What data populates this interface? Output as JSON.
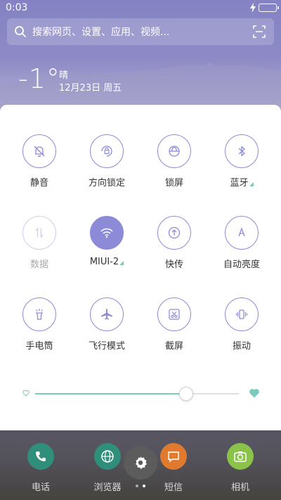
{
  "status_bar": {
    "time": "0:03"
  },
  "search": {
    "placeholder": "搜索网页、设置、应用、视频..."
  },
  "weather": {
    "temperature": "-1°",
    "condition": "晴",
    "date": "12月23日 周五"
  },
  "tiles": [
    {
      "label": "静音",
      "icon": "bell-off-icon",
      "state": "off"
    },
    {
      "label": "方向锁定",
      "icon": "rotation-lock-icon",
      "state": "off"
    },
    {
      "label": "锁屏",
      "icon": "lock-icon",
      "state": "off"
    },
    {
      "label": "蓝牙",
      "icon": "bluetooth-icon",
      "state": "off",
      "has_more": true
    },
    {
      "label": "数据",
      "icon": "mobile-data-icon",
      "state": "disabled"
    },
    {
      "label": "MIUI-2",
      "icon": "wifi-icon",
      "state": "on",
      "has_more": true
    },
    {
      "label": "快传",
      "icon": "quick-transfer-icon",
      "state": "off"
    },
    {
      "label": "自动亮度",
      "icon": "auto-brightness-icon",
      "state": "off"
    },
    {
      "label": "手电筒",
      "icon": "flashlight-icon",
      "state": "off"
    },
    {
      "label": "飞行模式",
      "icon": "airplane-icon",
      "state": "off"
    },
    {
      "label": "截屏",
      "icon": "screenshot-icon",
      "state": "off"
    },
    {
      "label": "振动",
      "icon": "vibrate-icon",
      "state": "off"
    }
  ],
  "brightness": {
    "level": 0.74
  },
  "dock": [
    {
      "label": "电话",
      "icon": "phone-icon",
      "color": "#2f8f7a"
    },
    {
      "label": "浏览器",
      "icon": "browser-icon",
      "color": "#2f8f7a"
    },
    {
      "label": "短信",
      "icon": "message-icon",
      "color": "#e07a2e"
    },
    {
      "label": "相机",
      "icon": "camera-icon",
      "color": "#8bc34a"
    }
  ],
  "colors": {
    "accent": "#8d8ad8",
    "brightness_fill": "#7ccabb"
  }
}
